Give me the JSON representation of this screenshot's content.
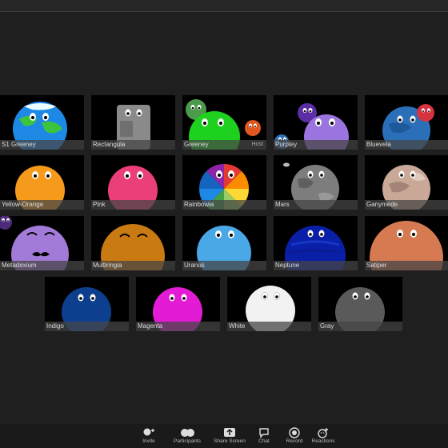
{
  "participants": [
    {
      "name": "S1 Greeney"
    },
    {
      "name": "Rectangula"
    },
    {
      "name": "Greeney",
      "badge": "Host"
    },
    {
      "name": "Purpley"
    },
    {
      "name": "Bluevela"
    },
    {
      "name": "Yellow-Orange"
    },
    {
      "name": "Pink"
    },
    {
      "name": "Rainbowia"
    },
    {
      "name": "Mars"
    },
    {
      "name": "Ganymede"
    },
    {
      "name": "Metadexium"
    },
    {
      "name": "Multiringia"
    },
    {
      "name": "Uranus"
    },
    {
      "name": "Neptune"
    },
    {
      "name": "Satiper"
    },
    {
      "name": "Indigo"
    },
    {
      "name": "Magenta"
    },
    {
      "name": "White"
    },
    {
      "name": "Gray"
    }
  ],
  "toolbar": {
    "invite": "Invite",
    "participants": "Participants",
    "share_screen": "Share Screen",
    "chat": "Chat",
    "record": "Record",
    "reactions": "Reactions"
  },
  "colors": {
    "background": "#1f1f1f",
    "tile": "#000000",
    "name_bar": "#464646",
    "record_red": "#ffffff"
  }
}
